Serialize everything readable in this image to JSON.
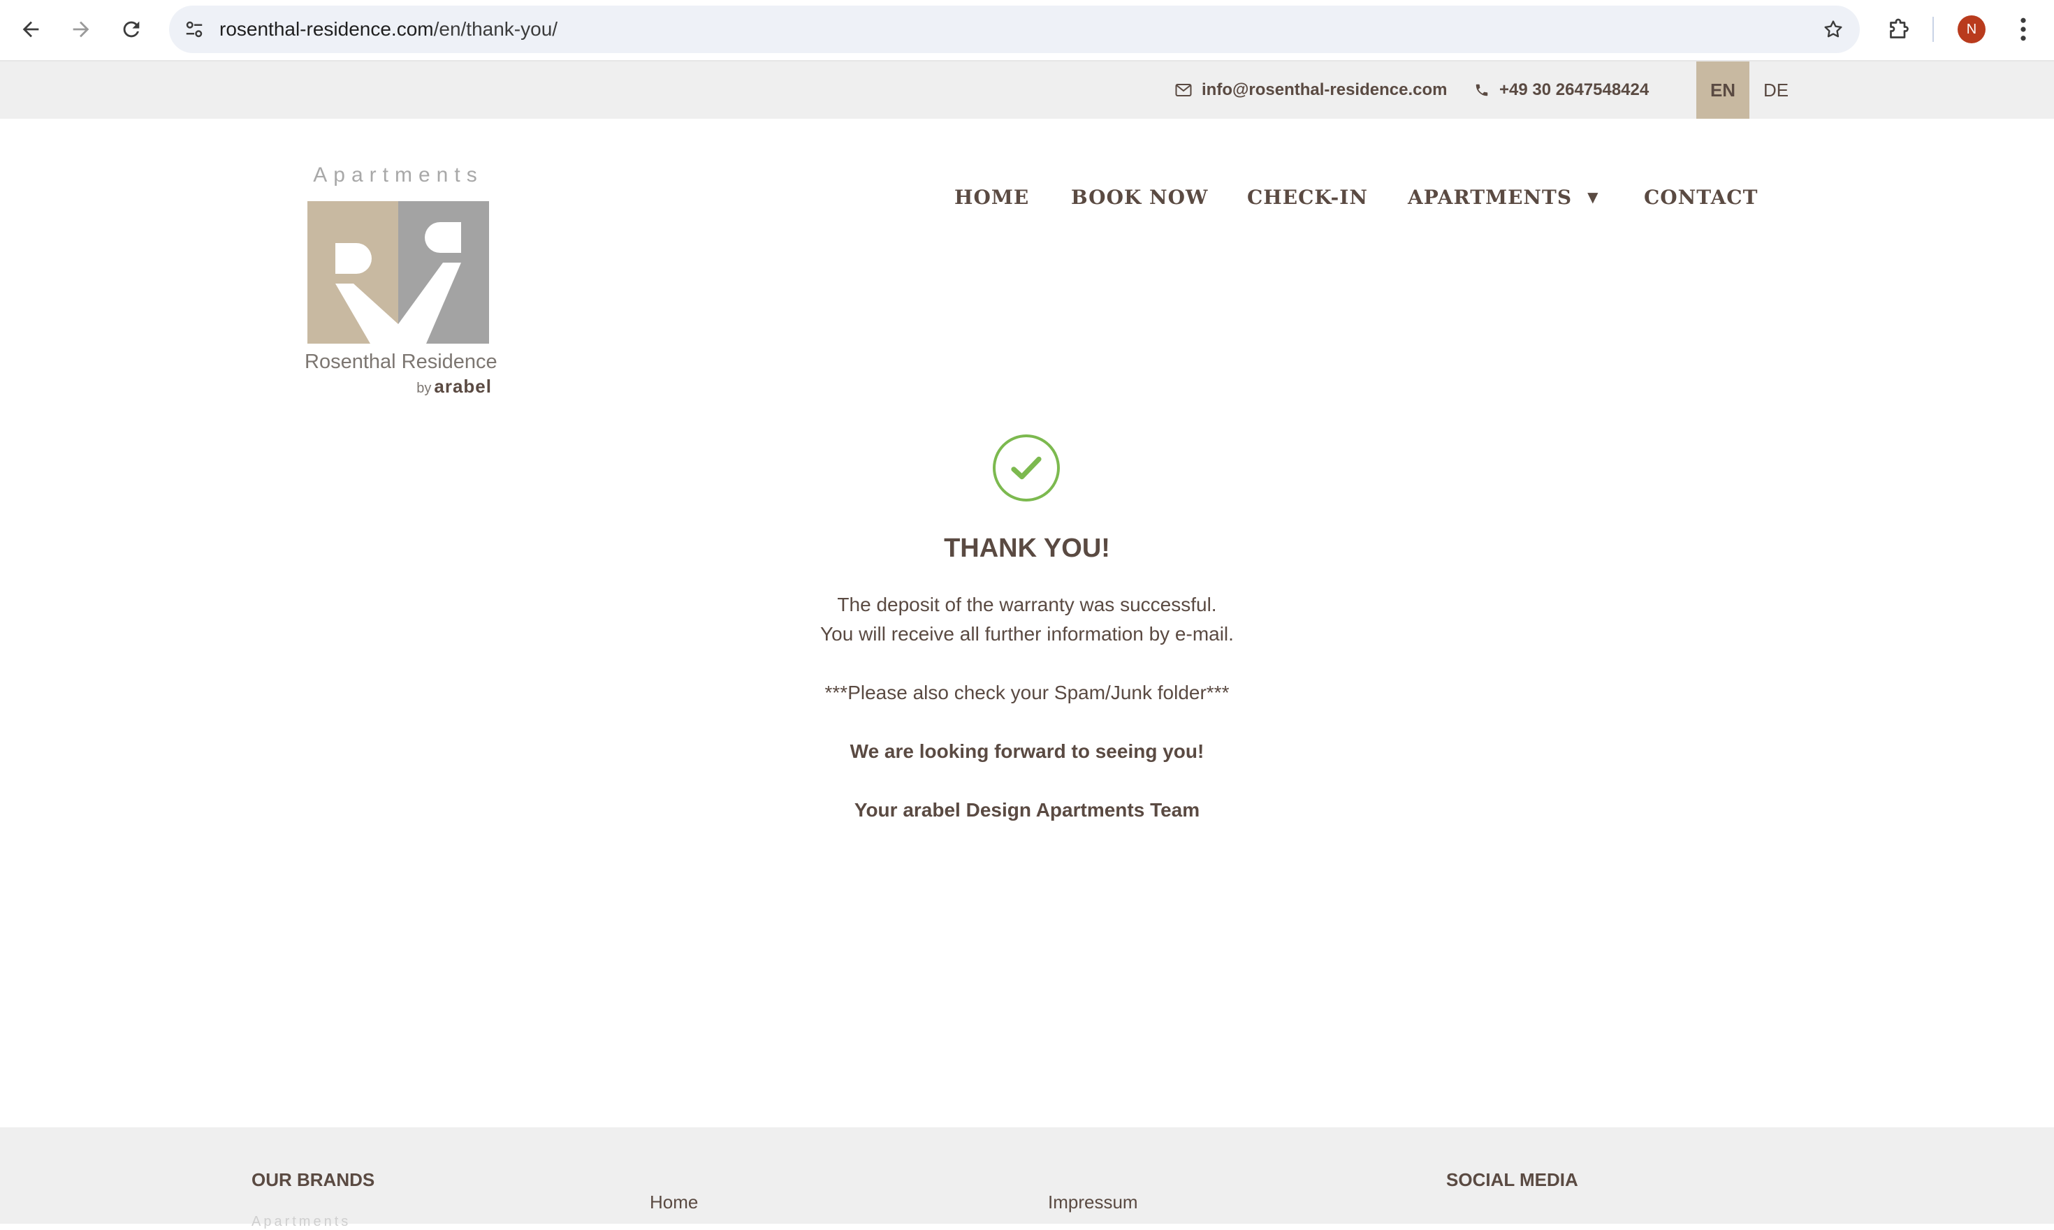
{
  "browser": {
    "url_host": "rosenthal-residence.com",
    "url_path": "/en/thank-you/",
    "profile_initial": "N"
  },
  "topbar": {
    "email": "info@rosenthal-residence.com",
    "phone": "+49 30 2647548424",
    "languages": [
      "EN",
      "DE"
    ],
    "active_language": "EN"
  },
  "logo": {
    "tagline": "Apartments",
    "name": "Rosenthal Residence",
    "by": "by",
    "brand": "arabel"
  },
  "nav": {
    "home": "HOME",
    "book_now": "BOOK NOW",
    "check_in": "CHECK-IN",
    "apartments": "APARTMENTS",
    "contact": "CONTACT"
  },
  "message": {
    "title": "THANK YOU!",
    "line1": "The deposit of the warranty was successful.",
    "line2": "You will receive all further information by e-mail.",
    "spam_note": "***Please also check your Spam/Junk folder***",
    "looking_forward": "We are looking forward to seeing you!",
    "signature": "Your arabel Design Apartments Team"
  },
  "footer": {
    "brands_heading": "OUR BRANDS",
    "brands_faded": "Apartments",
    "link_home": "Home",
    "link_impressum": "Impressum",
    "social_heading": "SOCIAL MEDIA"
  },
  "colors": {
    "brand_text": "#5a4a42",
    "accent_beige": "#c8b9a1",
    "logo_grey": "#a3a3a3",
    "success_green": "#7cb94f",
    "bar_grey": "#efefef"
  }
}
